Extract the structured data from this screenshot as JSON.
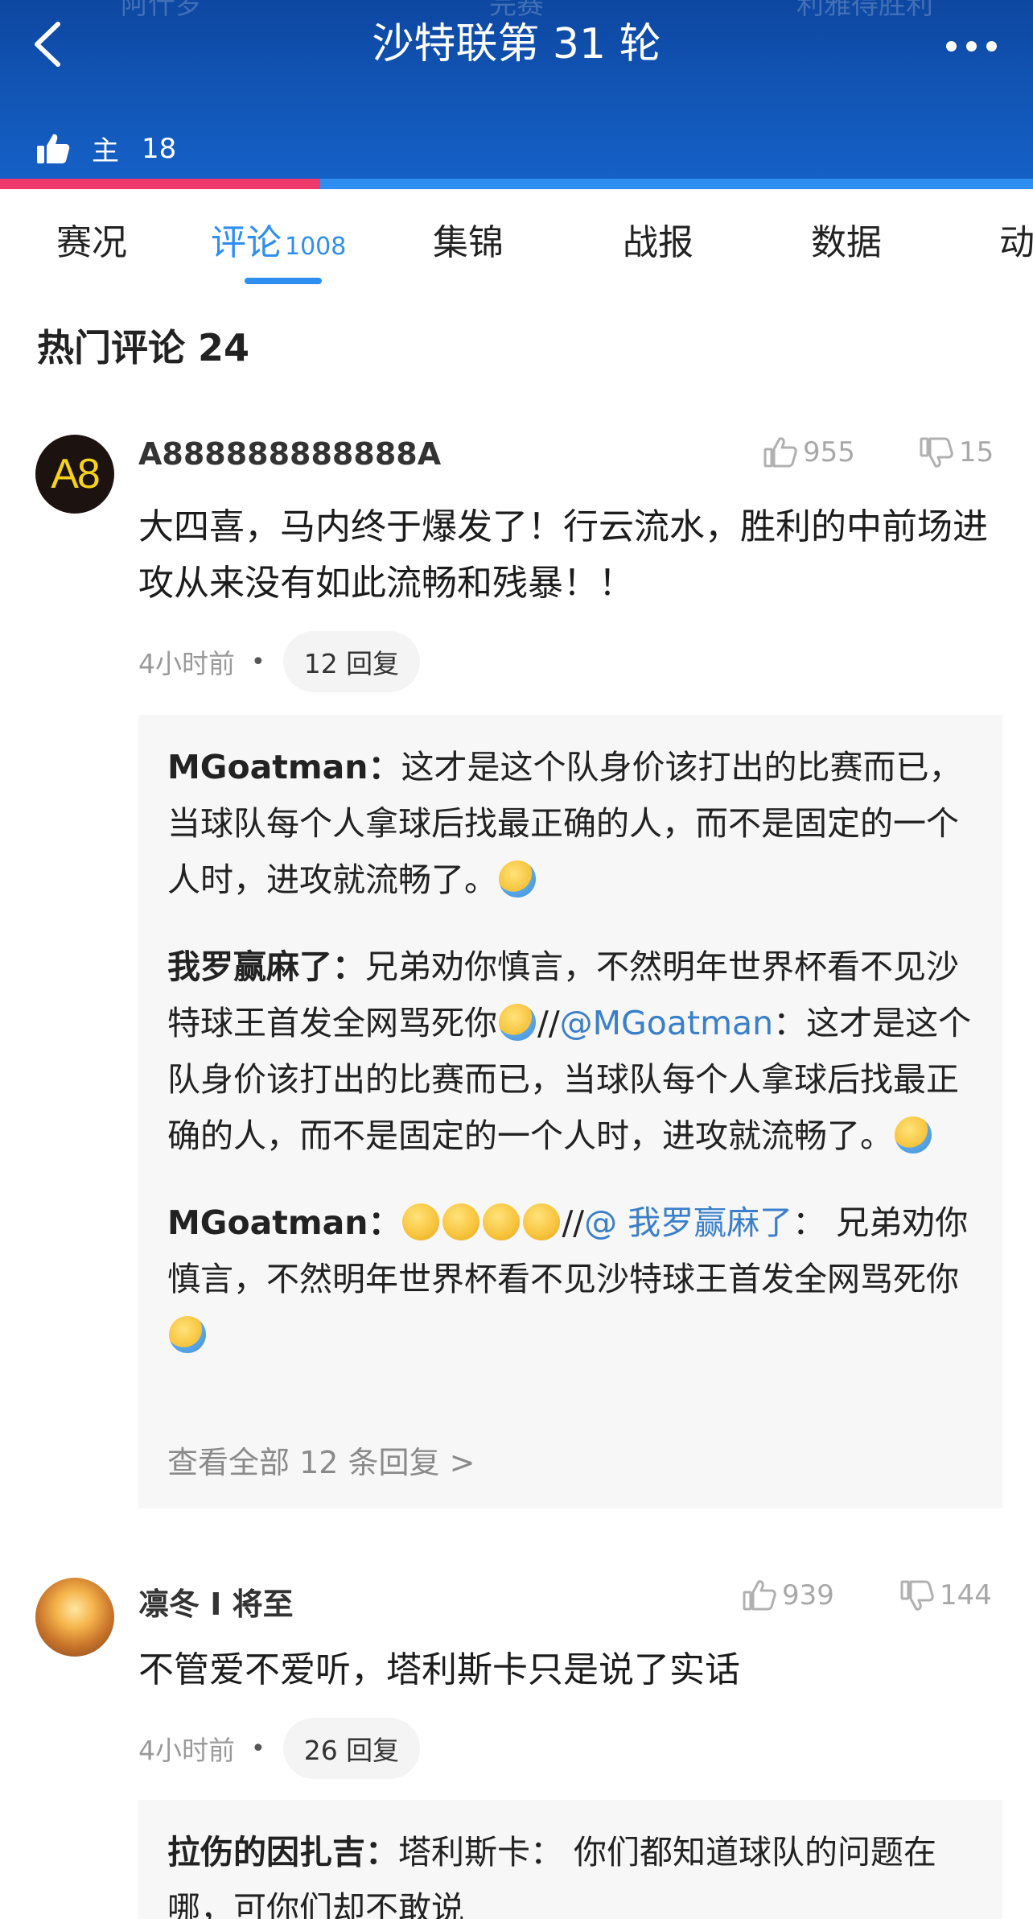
{
  "header": {
    "ghost_left": "阿什罗",
    "ghost_center": "完赛",
    "ghost_right": "利雅得胜利",
    "title": "沙特联第 31 轮",
    "likes_label": "主",
    "likes_count": "18",
    "home_ratio": 0.31,
    "colors": {
      "header_bg": "#1257b8",
      "home_bar": "#f0386a",
      "away_bar": "#2f8ff0"
    }
  },
  "tabs": [
    {
      "label": "赛况"
    },
    {
      "label": "评论",
      "count": "1008",
      "active": true
    },
    {
      "label": "集锦"
    },
    {
      "label": "战报"
    },
    {
      "label": "数据"
    },
    {
      "label": "动"
    }
  ],
  "section": {
    "title": "热门评论 24"
  },
  "comments": [
    {
      "avatar_text": "A8",
      "user": "A888888888888A",
      "likes": "955",
      "dislikes": "15",
      "text": "大四喜，马内终于爆发了！行云流水，胜利的中前场进攻从来没有如此流畅和残暴！！",
      "time": "4小时前",
      "dot": "•",
      "reply_count": "12 回复",
      "replies": [
        {
          "user": "MGoatman：",
          "text": "这才是这个队身价该打出的比赛而已，当球队每个人拿球后找最正确的人，而不是固定的一个人时，进攻就流畅了。"
        },
        {
          "user": "我罗赢麻了：",
          "text": "兄弟劝你慎言，不然明年世界杯看不见沙特球王首发全网骂死你",
          "sep": "//",
          "mention": "@MGoatman",
          "quote": "：这才是这个队身价该打出的比赛而已，当球队每个人拿球后找最正确的人，而不是固定的一个人时，进攻就流畅了。"
        },
        {
          "user": "MGoatman：",
          "sep": "//",
          "mention": "@ 我罗赢麻了",
          "quote": "：  兄弟劝你慎言，不然明年世界杯看不见沙特球王首发全网骂死你"
        }
      ],
      "view_all": "查看全部 12 条回复 >"
    },
    {
      "user": "凛冬 I 将至",
      "likes": "939",
      "dislikes": "144",
      "text": "不管爱不爱听，塔利斯卡只是说了实话",
      "time": "4小时前",
      "dot": "•",
      "reply_count": "26 回复",
      "replies": [
        {
          "user": "拉伤的因扎吉：",
          "text": "塔利斯卡：  你们都知道球队的问题在哪，可你们却不敢说"
        }
      ]
    }
  ],
  "icons": {
    "back": "chevron-left-icon",
    "more": "more-dots-icon",
    "like": "thumbs-up-icon",
    "dislike": "thumbs-down-icon",
    "emoji_shy": "shy-emoji-icon",
    "emoji_laugh": "laughing-emoji-icon"
  }
}
